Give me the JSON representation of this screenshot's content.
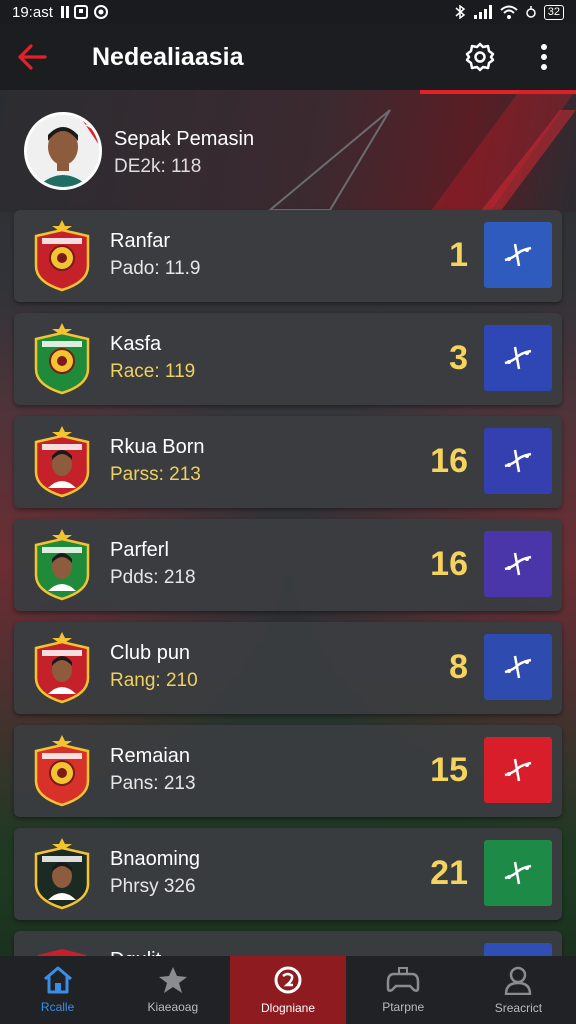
{
  "status_bar": {
    "time": "19:ast",
    "battery": "32"
  },
  "app_bar": {
    "title": "Nedealiaasia",
    "back_icon": "arrow-left-icon",
    "settings_icon": "gear-icon",
    "menu_icon": "more-vertical-icon",
    "accent": "#e32228"
  },
  "hero": {
    "name": "Sepak Pemasin",
    "subtitle": "DE2k: 118"
  },
  "items": [
    {
      "title": "Ranfar",
      "subtitle": "Pado: 11.9",
      "value": "1",
      "button_color": "#2f5bbf",
      "badge_color": "#c4212b",
      "badge_has_face": false,
      "sub_gold": false
    },
    {
      "title": "Kasfa",
      "subtitle": "Race: 119",
      "value": "3",
      "button_color": "#2f47b5",
      "badge_color": "#1f8a3a",
      "badge_has_face": false,
      "sub_gold": true
    },
    {
      "title": "Rkua Born",
      "subtitle": "Parss: 213",
      "value": "16",
      "button_color": "#3440b0",
      "badge_color": "#c4212b",
      "badge_has_face": true,
      "sub_gold": true
    },
    {
      "title": "Parferl",
      "subtitle": "Pdds: 218",
      "value": "16",
      "button_color": "#4a36a8",
      "badge_color": "#1f8a3a",
      "badge_has_face": true,
      "sub_gold": false
    },
    {
      "title": "Club pun",
      "subtitle": "Rang: 210",
      "value": "8",
      "button_color": "#2e4cb0",
      "badge_color": "#c4212b",
      "badge_has_face": true,
      "sub_gold": true
    },
    {
      "title": "Remaian",
      "subtitle": "Pans: 213",
      "value": "15",
      "button_color": "#d81e2a",
      "badge_color": "#d8312a",
      "badge_has_face": false,
      "sub_gold": false
    },
    {
      "title": "Bnaoming",
      "subtitle": "Phrsy 326",
      "value": "21",
      "button_color": "#1e8a48",
      "badge_color": "#1b2a22",
      "badge_has_face": true,
      "sub_gold": false
    }
  ],
  "partial_item": {
    "title": "Dgulit"
  },
  "bottom_nav": [
    {
      "label": "Rcalle",
      "icon": "home-icon"
    },
    {
      "label": "Kiaeaoag",
      "icon": "star-icon"
    },
    {
      "label": "Dlogniane",
      "icon": "target-icon"
    },
    {
      "label": "Ptarpne",
      "icon": "controller-icon"
    },
    {
      "label": "Sreacrict",
      "icon": "person-icon"
    }
  ]
}
